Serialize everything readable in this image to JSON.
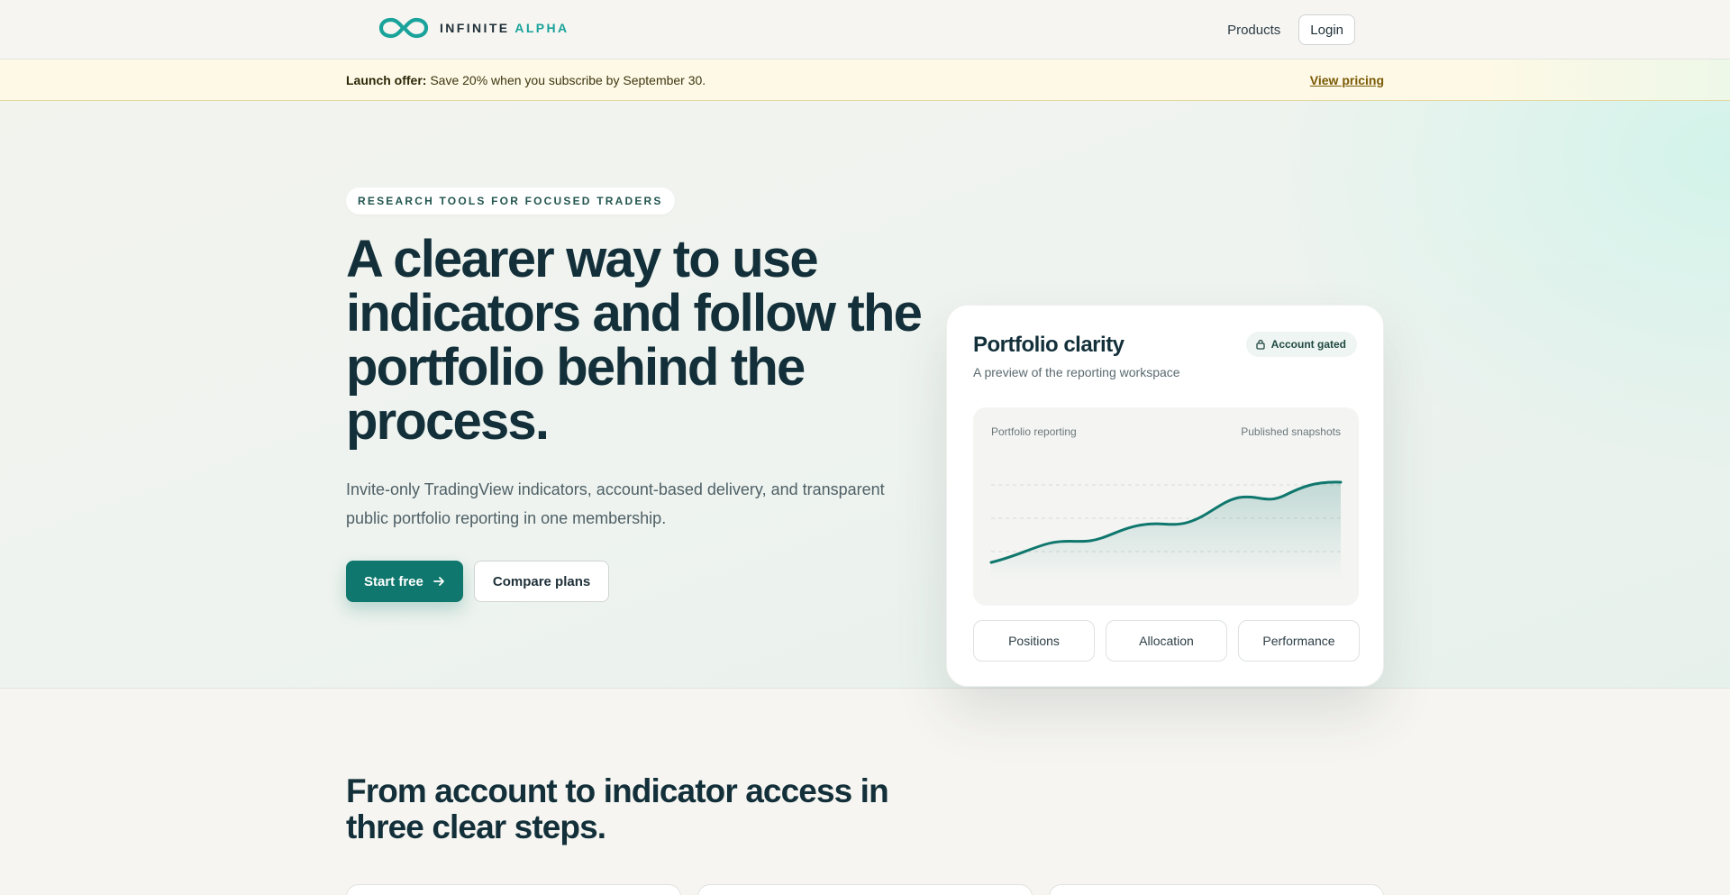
{
  "header": {
    "brand_primary": "INFINITE",
    "brand_accent": "ALPHA",
    "nav": {
      "products": "Products",
      "login": "Login"
    }
  },
  "promo": {
    "label": "Launch offer:",
    "text": "Save 20% when you subscribe by September 30.",
    "link": "View pricing"
  },
  "hero": {
    "eyebrow": "RESEARCH TOOLS FOR FOCUSED TRADERS",
    "headline": "A clearer way to use indicators and follow the portfolio behind the process.",
    "subtext": "Invite-only TradingView indicators, account-based delivery, and transparent public portfolio reporting in one membership.",
    "cta_primary": "Start free",
    "cta_secondary": "Compare plans"
  },
  "card": {
    "title": "Portfolio clarity",
    "subtitle": "A preview of the reporting workspace",
    "badge": "Account gated",
    "chart_label_left": "Portfolio reporting",
    "chart_label_right": "Published snapshots",
    "tabs": [
      "Positions",
      "Allocation",
      "Performance"
    ]
  },
  "steps": {
    "heading": "From account to indicator access in three clear steps."
  },
  "colors": {
    "brand_teal": "#0f776d",
    "logo_teal": "#1aa39a",
    "ink": "#13303a",
    "promo_bg": "#fef9e6"
  },
  "icons": [
    "infinity-logo-icon",
    "arrow-right-icon",
    "lock-icon"
  ]
}
